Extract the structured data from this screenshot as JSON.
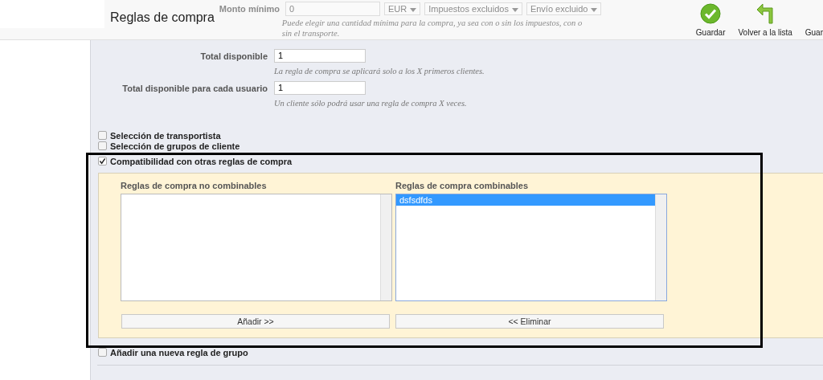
{
  "header": {
    "title": "Reglas de compra",
    "behind": {
      "label": "Monto mínimo",
      "value": "0",
      "selects": [
        "EUR",
        "Impuestos excluidos",
        "Envío excluido"
      ],
      "hint_lines": [
        "Puede elegir una cantidad mínima para la compra, ya sea con o sin los impuestos, con o",
        "sin el transporte."
      ]
    }
  },
  "toolbar": [
    {
      "kind": "check",
      "label": "Guardar"
    },
    {
      "kind": "back",
      "label": "Volver a la lista"
    },
    {
      "kind": "none",
      "label": "Guar"
    }
  ],
  "fields": [
    {
      "label": "Total disponible",
      "value": "1",
      "hint": "La regla de compra se aplicará solo a los X primeros clientes."
    },
    {
      "label": "Total disponible para cada usuario",
      "value": "1",
      "hint": "Un cliente sólo podrá usar una regla de compra X veces."
    }
  ],
  "conditions": [
    {
      "label": "Selección de transportista",
      "checked": false
    },
    {
      "label": "Selección de grupos de cliente",
      "checked": false
    },
    {
      "label": "Compatibilidad con otras reglas de compra",
      "checked": true
    }
  ],
  "compat": {
    "lists": [
      {
        "heading": "Reglas de compra no combinables"
      },
      {
        "heading": "Reglas de compra combinables",
        "items": [
          {
            "label": "dsfsdfds",
            "selected": true
          }
        ]
      }
    ],
    "buttons": [
      "Añadir >>",
      "<< Eliminar"
    ]
  },
  "group_rule": {
    "label": "Añadir una nueva regla de grupo",
    "checked": false
  }
}
